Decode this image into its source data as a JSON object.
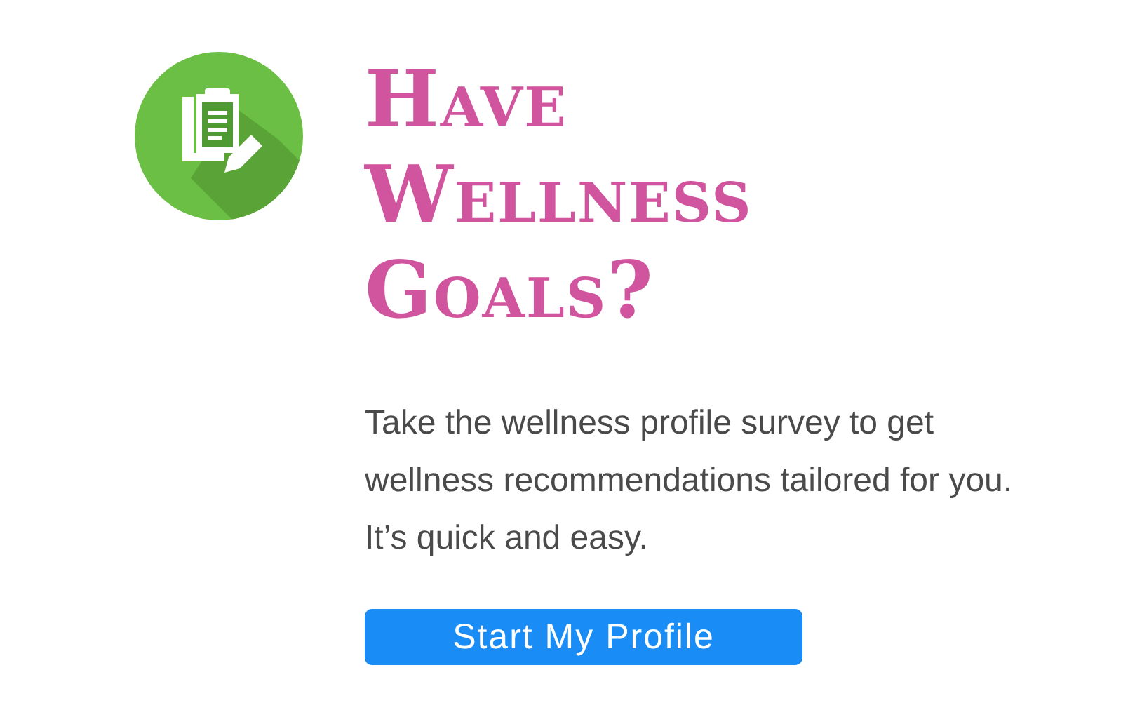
{
  "heading": "Have Wellness Goals?",
  "description": "Take the wellness profile survey to get wellness recommendations tailored for you. It’s quick and easy.",
  "button": {
    "label": "Start My Profile"
  }
}
